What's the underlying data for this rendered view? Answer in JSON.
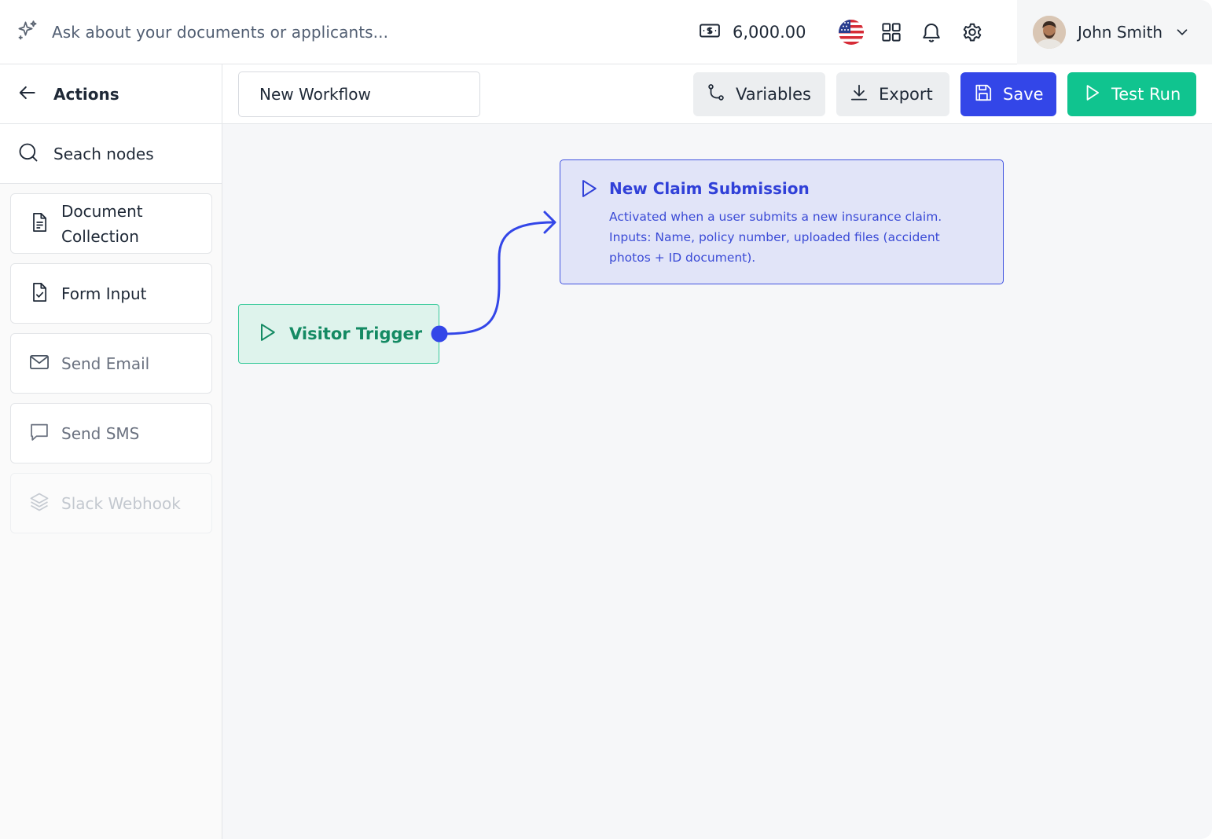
{
  "topbar": {
    "ask_placeholder": "Ask about your documents or applicants...",
    "ask_icon": "sparkles-icon",
    "credits": "6,000.00",
    "credits_icon": "money-icon",
    "flag_icon": "us-flag-icon",
    "grid_icon": "apps-grid-icon",
    "bell_icon": "bell-icon",
    "settings_icon": "gear-icon",
    "user_name": "John Smith"
  },
  "sidebar": {
    "title": "Actions",
    "back_icon": "arrow-left-icon",
    "search_placeholder": "Seach nodes",
    "items": [
      {
        "label_line1": "Document",
        "label_line2": "Collection",
        "icon": "document-icon"
      },
      {
        "label": "Form Input",
        "icon": "file-check-icon"
      },
      {
        "label": "Send Email",
        "icon": "mail-icon"
      },
      {
        "label": "Send SMS",
        "icon": "message-icon"
      },
      {
        "label": "Slack Webhook",
        "icon": "layers-icon"
      }
    ]
  },
  "toolbar": {
    "workflow_name": "New Workflow",
    "variables_label": "Variables",
    "export_label": "Export",
    "save_label": "Save",
    "test_run_label": "Test Run"
  },
  "canvas": {
    "trigger_node": {
      "label": "Visitor Trigger",
      "icon": "play-icon"
    },
    "claim_node": {
      "title": "New Claim Submission",
      "description": "Activated when a user submits a new insurance claim. Inputs: Name, policy number, uploaded files (accident photos + ID document).",
      "icon": "play-icon"
    }
  },
  "colors": {
    "primary_blue": "#3346e8",
    "accent_green": "#10c48f",
    "trigger_text": "#148a63",
    "claim_text": "#3040d8"
  }
}
